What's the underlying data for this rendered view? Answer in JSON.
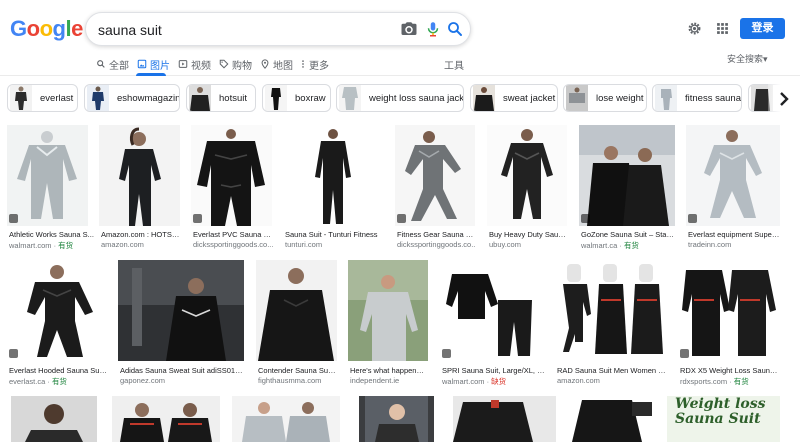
{
  "logo": [
    "G",
    "o",
    "o",
    "g",
    "l",
    "e"
  ],
  "search": {
    "query": "sauna suit"
  },
  "header": {
    "login": "登录"
  },
  "tabs": [
    {
      "label": "全部",
      "icon": "search-icon"
    },
    {
      "label": "图片",
      "icon": "image-icon",
      "active": true
    },
    {
      "label": "视频",
      "icon": "video-icon"
    },
    {
      "label": "购物",
      "icon": "tag-icon"
    },
    {
      "label": "地图",
      "icon": "map-pin-icon"
    },
    {
      "label": "更多",
      "icon": "more-vert-icon"
    }
  ],
  "tools": "工具",
  "safesearch": "安全搜索▾",
  "chips": [
    "everlast",
    "eshowmagazine",
    "hotsuit",
    "boxraw",
    "weight loss sauna jacket",
    "sweat jacket",
    "lose weight",
    "fitness sauna"
  ],
  "row1": [
    {
      "title": "Athletic Works Sauna S...",
      "src": "walmart.com · ",
      "tag": "有货",
      "tagType": "g"
    },
    {
      "title": "Amazon.com : HOTSUI...",
      "src": "amazon.com",
      "tag": "",
      "tagType": ""
    },
    {
      "title": "Everlast PVC Sauna sui...",
      "src": "dickssportinggoods.co...",
      "tag": "",
      "tagType": ""
    },
    {
      "title": "Sauna Suit - Tunturi Fitness",
      "src": "tunturi.com",
      "tag": "",
      "tagType": ""
    },
    {
      "title": "Fitness Gear Sauna Sui...",
      "src": "dickssportinggoods.co...",
      "tag": "",
      "tagType": ""
    },
    {
      "title": "Buy Heavy Duty Sauna ...",
      "src": "ubuy.com",
      "tag": "",
      "tagType": ""
    },
    {
      "title": "GoZone Sauna Suit – Stand...",
      "src": "walmart.ca · ",
      "tag": "有货",
      "tagType": "g"
    },
    {
      "title": "Everlast equipment Super S...",
      "src": "tradeinn.com",
      "tag": "",
      "tagType": ""
    }
  ],
  "row2": [
    {
      "title": "Everlast Hooded Sauna Suit –...",
      "src": "everlast.ca · ",
      "tag": "有货",
      "tagType": "g"
    },
    {
      "title": "Adidas Sauna Sweat Suit adiSS01 fro...",
      "src": "gaponez.com",
      "tag": "",
      "tagType": ""
    },
    {
      "title": "Contender Sauna Suit -...",
      "src": "fighthausmma.com",
      "tag": "",
      "tagType": ""
    },
    {
      "title": "Here's what happened ...",
      "src": "independent.ie",
      "tag": "",
      "tagType": ""
    },
    {
      "title": "SPRI Sauna Suit, Large/XL, Dur...",
      "src": "walmart.com · ",
      "tag": "缺货",
      "tagType": "r"
    },
    {
      "title": "RAD Sauna Suit Men Women Wei...",
      "src": "amazon.com",
      "tag": "",
      "tagType": ""
    },
    {
      "title": "RDX X5 Weight Loss Sauna S...",
      "src": "rdxsports.com · ",
      "tag": "有货",
      "tagType": "g"
    }
  ],
  "row3_text": "Weight loss Sauna Suit",
  "colors": {
    "accent": "#1a73e8",
    "in_stock": "#188038",
    "out_of_stock": "#d93025"
  }
}
